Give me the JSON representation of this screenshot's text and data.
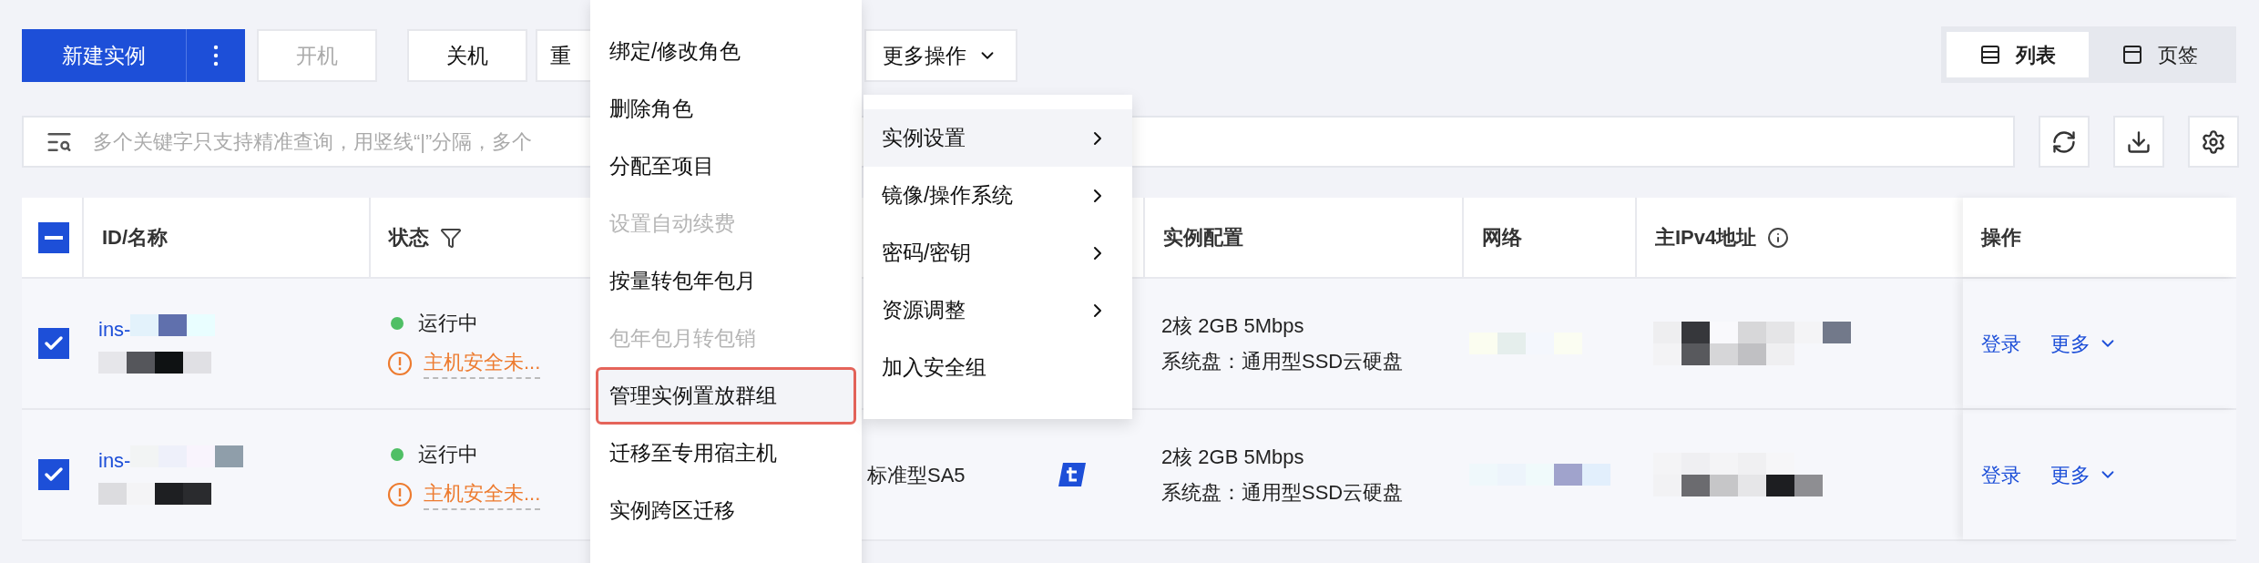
{
  "toolbar": {
    "primary_button": "新建实例",
    "buttons": [
      {
        "label": "开机",
        "disabled": true
      },
      {
        "label": "关机",
        "disabled": false
      },
      {
        "label": "重",
        "disabled": false
      }
    ],
    "more_button": "更多操作"
  },
  "view_toggle": [
    {
      "label": "列表",
      "selected": true,
      "kind": "list"
    },
    {
      "label": "页签",
      "selected": false,
      "kind": "tabs"
    }
  ],
  "search": {
    "placeholder": "多个关键字只支持精准查询，用竖线“|”分隔，多个"
  },
  "table": {
    "select_all_partial": true,
    "columns": [
      {
        "label": "ID/名称",
        "kind": "plain"
      },
      {
        "label": "状态",
        "kind": "filter"
      },
      {
        "label": "实例配置",
        "kind": "plain"
      },
      {
        "label": "网络",
        "kind": "plain"
      },
      {
        "label": "主IPv4地址",
        "kind": "info"
      },
      {
        "label": "操作",
        "kind": "plain"
      }
    ],
    "rows": [
      {
        "checked": true,
        "id": "ins-",
        "status": "运行中",
        "warning": "主机安全未...",
        "model": "",
        "config": [
          "2核 2GB 5Mbps",
          "系统盘：通用型SSD云硬盘"
        ],
        "actions": [
          "登录",
          "更多"
        ]
      },
      {
        "checked": true,
        "id": "ins-",
        "status": "运行中",
        "warning": "主机安全未...",
        "model": "标准型SA5",
        "config": [
          "2核 2GB 5Mbps",
          "系统盘：通用型SSD云硬盘"
        ],
        "actions": [
          "登录",
          "更多"
        ]
      }
    ]
  },
  "menu": [
    {
      "label": "绑定/修改角色",
      "disabled": false,
      "highlighted": false
    },
    {
      "label": "删除角色",
      "disabled": false,
      "highlighted": false
    },
    {
      "label": "分配至项目",
      "disabled": false,
      "highlighted": false
    },
    {
      "label": "设置自动续费",
      "disabled": true,
      "highlighted": false
    },
    {
      "label": "按量转包年包月",
      "disabled": false,
      "highlighted": false
    },
    {
      "label": "包年包月转包销",
      "disabled": true,
      "highlighted": false
    },
    {
      "label": "管理实例置放群组",
      "disabled": false,
      "highlighted": true
    },
    {
      "label": "迁移至专用宿主机",
      "disabled": false,
      "highlighted": false
    },
    {
      "label": "实例跨区迁移",
      "disabled": false,
      "highlighted": false
    }
  ],
  "submenu": [
    {
      "label": "实例设置",
      "has_children": true,
      "hovered": true
    },
    {
      "label": "镜像/操作系统",
      "has_children": true,
      "hovered": false
    },
    {
      "label": "密码/密钥",
      "has_children": true,
      "hovered": false
    },
    {
      "label": "资源调整",
      "has_children": true,
      "hovered": false
    },
    {
      "label": "加入安全组",
      "has_children": false,
      "hovered": false
    }
  ]
}
